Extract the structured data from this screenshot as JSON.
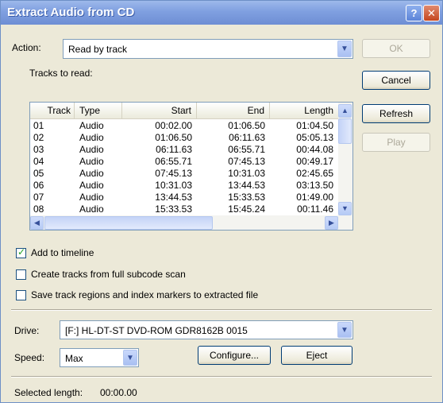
{
  "window": {
    "title": "Extract Audio from CD",
    "help_icon": "?",
    "close_icon": "✕"
  },
  "action": {
    "label": "Action:",
    "value": "Read by track"
  },
  "buttons": {
    "ok": "OK",
    "cancel": "Cancel",
    "refresh": "Refresh",
    "play": "Play",
    "configure": "Configure...",
    "eject": "Eject"
  },
  "tracks": {
    "label": "Tracks to read:",
    "columns": [
      "Track",
      "Type",
      "Start",
      "End",
      "Length"
    ],
    "rows": [
      [
        "01",
        "Audio",
        "00:02.00",
        "01:06.50",
        "01:04.50"
      ],
      [
        "02",
        "Audio",
        "01:06.50",
        "06:11.63",
        "05:05.13"
      ],
      [
        "03",
        "Audio",
        "06:11.63",
        "06:55.71",
        "00:44.08"
      ],
      [
        "04",
        "Audio",
        "06:55.71",
        "07:45.13",
        "00:49.17"
      ],
      [
        "05",
        "Audio",
        "07:45.13",
        "10:31.03",
        "02:45.65"
      ],
      [
        "06",
        "Audio",
        "10:31.03",
        "13:44.53",
        "03:13.50"
      ],
      [
        "07",
        "Audio",
        "13:44.53",
        "15:33.53",
        "01:49.00"
      ],
      [
        "08",
        "Audio",
        "15:33.53",
        "15:45.24",
        "00:11.46"
      ]
    ]
  },
  "options": {
    "add_to_timeline": {
      "label": "Add to timeline",
      "checked": true
    },
    "create_tracks": {
      "label": "Create tracks from full subcode scan",
      "checked": false
    },
    "save_regions": {
      "label": "Save track regions and index markers to extracted file",
      "checked": false
    }
  },
  "drive": {
    "label": "Drive:",
    "value": "[F:] HL-DT-ST DVD-ROM GDR8162B 0015"
  },
  "speed": {
    "label": "Speed:",
    "value": "Max"
  },
  "status": {
    "label": "Selected length:",
    "value": "00:00.00"
  },
  "icons": {
    "dropdown": "chevron-down",
    "scroll_up": "▲",
    "scroll_down": "▼",
    "scroll_left": "◀",
    "scroll_right": "▶"
  }
}
